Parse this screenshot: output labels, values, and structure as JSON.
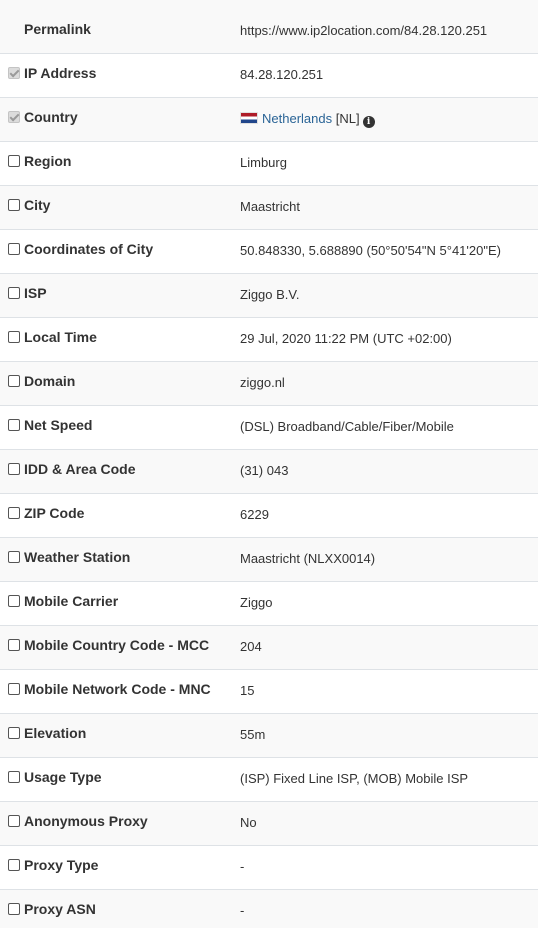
{
  "rows": [
    {
      "label": "Permalink",
      "value": "https://www.ip2location.com/84.28.120.251",
      "checkbox": "none"
    },
    {
      "label": "IP Address",
      "value": "84.28.120.251",
      "checkbox": "checked-disabled"
    },
    {
      "label": "Country",
      "value": "Netherlands",
      "suffix": "[NL]",
      "checkbox": "checked-disabled",
      "flag": "netherlands-flag-icon",
      "info_icon": "info-circle-icon"
    },
    {
      "label": "Region",
      "value": "Limburg",
      "checkbox": "unchecked"
    },
    {
      "label": "City",
      "value": "Maastricht",
      "checkbox": "unchecked"
    },
    {
      "label": "Coordinates of City",
      "value": "50.848330, 5.688890 (50°50'54\"N   5°41'20\"E)",
      "checkbox": "unchecked"
    },
    {
      "label": "ISP",
      "value": "Ziggo B.V.",
      "checkbox": "unchecked"
    },
    {
      "label": "Local Time",
      "value": "29 Jul, 2020 11:22 PM (UTC +02:00)",
      "checkbox": "unchecked"
    },
    {
      "label": "Domain",
      "value": "ziggo.nl",
      "checkbox": "unchecked"
    },
    {
      "label": "Net Speed",
      "value": "(DSL) Broadband/Cable/Fiber/Mobile",
      "checkbox": "unchecked"
    },
    {
      "label": "IDD & Area Code",
      "value": "(31) 043",
      "checkbox": "unchecked"
    },
    {
      "label": "ZIP Code",
      "value": "6229",
      "checkbox": "unchecked"
    },
    {
      "label": "Weather Station",
      "value": "Maastricht (NLXX0014)",
      "checkbox": "unchecked"
    },
    {
      "label": "Mobile Carrier",
      "value": "Ziggo",
      "checkbox": "unchecked"
    },
    {
      "label": "Mobile Country Code - MCC",
      "value": "204",
      "checkbox": "unchecked"
    },
    {
      "label": "Mobile Network Code - MNC",
      "value": "15",
      "checkbox": "unchecked"
    },
    {
      "label": "Elevation",
      "value": "55m",
      "checkbox": "unchecked"
    },
    {
      "label": "Usage Type",
      "value": "(ISP) Fixed Line ISP, (MOB) Mobile ISP",
      "checkbox": "unchecked"
    },
    {
      "label": "Anonymous Proxy",
      "value": "No",
      "checkbox": "unchecked"
    },
    {
      "label": "Proxy Type",
      "value": "-",
      "checkbox": "unchecked"
    },
    {
      "label": "Proxy ASN",
      "value": "-",
      "checkbox": "unchecked"
    }
  ],
  "colors": {
    "link": "#2a6496",
    "row_stripe": "#f9f9f9",
    "border": "#dee2e6",
    "text": "#333333"
  }
}
